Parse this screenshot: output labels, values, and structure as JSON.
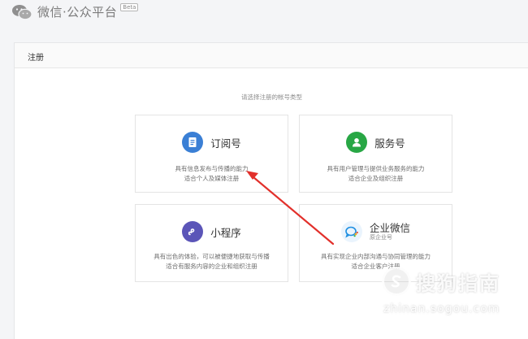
{
  "header": {
    "brand": "微信·公众平台",
    "badge": "Beta"
  },
  "panel": {
    "title": "注册",
    "prompt": "请选择注册的帐号类型"
  },
  "cards": [
    {
      "name": "订阅号",
      "desc1": "具有信息发布与传播的能力",
      "desc2": "适合个人及媒体注册",
      "icon": "document-icon",
      "color": "#3a7fd5"
    },
    {
      "name": "服务号",
      "desc1": "具有用户管理与提供业务服务的能力",
      "desc2": "适合企业及组织注册",
      "icon": "user-icon",
      "color": "#28a745"
    },
    {
      "name": "小程序",
      "desc1": "具有出色的体验，可以被便捷地获取与传播",
      "desc2": "适合有服务内容的企业和组织注册",
      "icon": "mini-program-icon",
      "color": "#5b55b8"
    },
    {
      "name": "企业微信",
      "sub": "原企业号",
      "desc1": "具有实现企业内部沟通与协同管理的能力",
      "desc2": "适合企业客户注册",
      "icon": "work-wechat-icon",
      "color": "#1e8fe1"
    }
  ],
  "watermark": {
    "text": "搜狗指南",
    "url": "zhinan.sogou.com"
  }
}
